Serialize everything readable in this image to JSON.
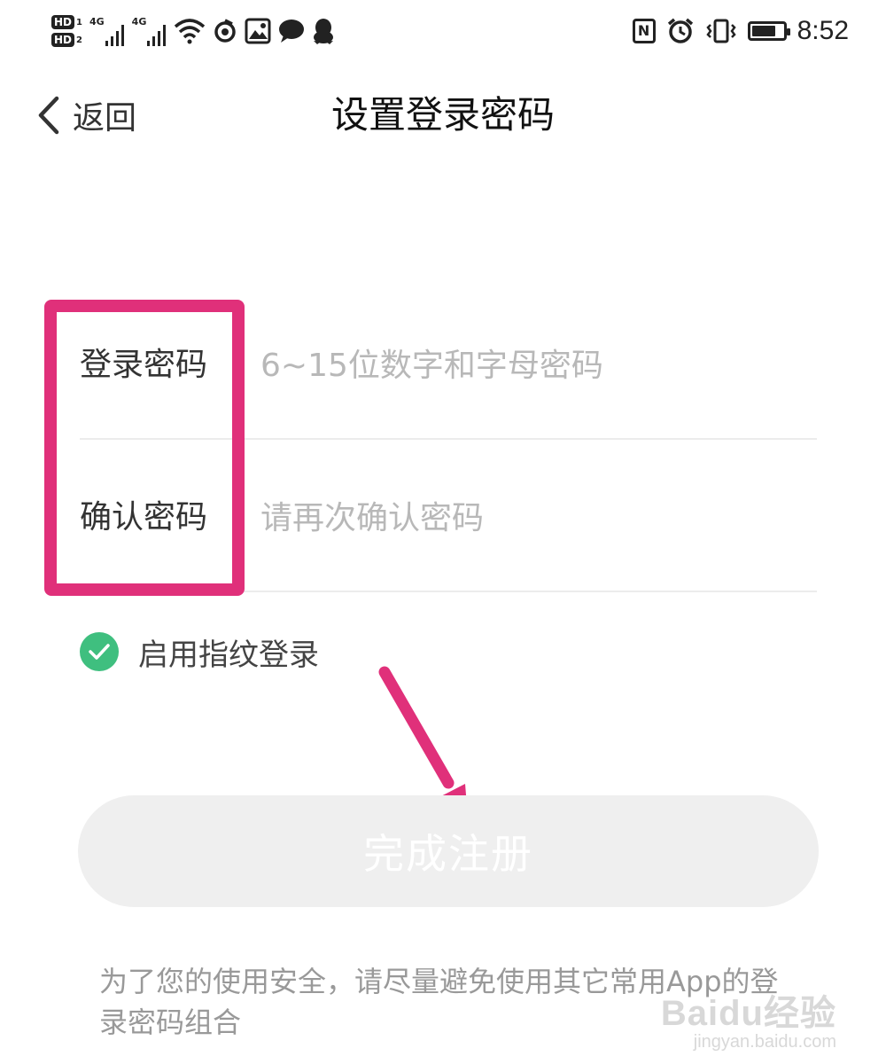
{
  "status_bar": {
    "hd1_label": "HD",
    "hd1_sub": "1",
    "hd2_label": "HD",
    "hd2_sub": "2",
    "sim1_network": "4G",
    "sim2_network": "4G",
    "nfc_label": "N",
    "time": "8:52",
    "icons": [
      "wifi-icon",
      "sync-icon",
      "image-alert-icon",
      "chat-bubble-icon",
      "qq-penguin-icon",
      "nfc-icon",
      "alarm-icon",
      "vibrate-icon",
      "battery-icon"
    ]
  },
  "nav": {
    "back_label": "返回",
    "title": "设置登录密码"
  },
  "form": {
    "password": {
      "label": "登录密码",
      "placeholder": "6~15位数字和字母密码",
      "value": ""
    },
    "confirm": {
      "label": "确认密码",
      "placeholder": "请再次确认密码",
      "value": ""
    }
  },
  "fingerprint": {
    "label": "启用指纹登录",
    "checked": true
  },
  "submit": {
    "label": "完成注册",
    "enabled": false
  },
  "footer": {
    "note": "为了您的使用安全，请尽量避免使用其它常用App的登录密码组合"
  },
  "watermark": {
    "main": "Baidu经验",
    "sub": "jingyan.baidu.com"
  },
  "colors": {
    "highlight": "#e0307a",
    "check": "#3fbf7f",
    "button_disabled_bg": "#efefef",
    "placeholder": "#b8b8b8"
  }
}
